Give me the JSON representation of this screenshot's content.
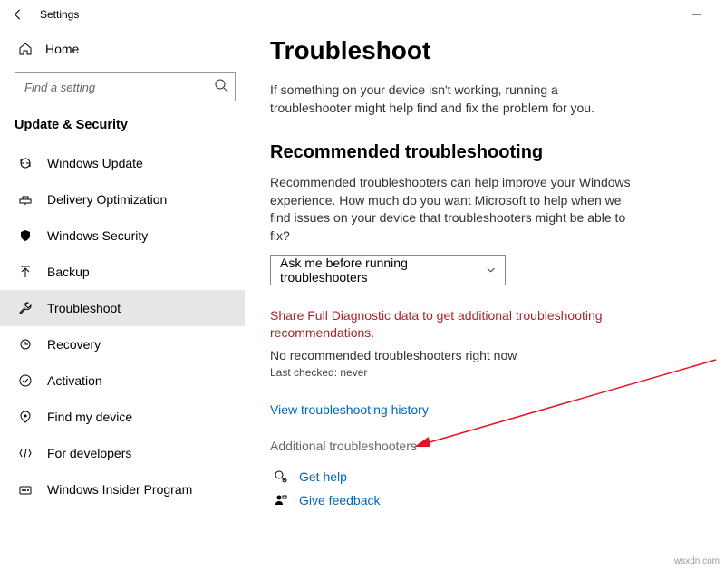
{
  "titlebar": {
    "title": "Settings"
  },
  "sidebar": {
    "home_label": "Home",
    "search_placeholder": "Find a setting",
    "section_heading": "Update & Security",
    "items": [
      {
        "label": "Windows Update"
      },
      {
        "label": "Delivery Optimization"
      },
      {
        "label": "Windows Security"
      },
      {
        "label": "Backup"
      },
      {
        "label": "Troubleshoot"
      },
      {
        "label": "Recovery"
      },
      {
        "label": "Activation"
      },
      {
        "label": "Find my device"
      },
      {
        "label": "For developers"
      },
      {
        "label": "Windows Insider Program"
      }
    ]
  },
  "main": {
    "title": "Troubleshoot",
    "description": "If something on your device isn't working, running a troubleshooter might help find and fix the problem for you.",
    "recommended_heading": "Recommended troubleshooting",
    "recommended_description": "Recommended troubleshooters can help improve your Windows experience. How much do you want Microsoft to help when we find issues on your device that troubleshooters might be able to fix?",
    "dropdown_value": "Ask me before running troubleshooters",
    "alert": "Share Full Diagnostic data to get additional troubleshooting recommendations.",
    "status": "No recommended troubleshooters right now",
    "last_checked": "Last checked: never",
    "history_link": "View troubleshooting history",
    "additional_heading": "Additional troubleshooters",
    "get_help": "Get help",
    "give_feedback": "Give feedback"
  },
  "watermark": "wsxdn.com"
}
